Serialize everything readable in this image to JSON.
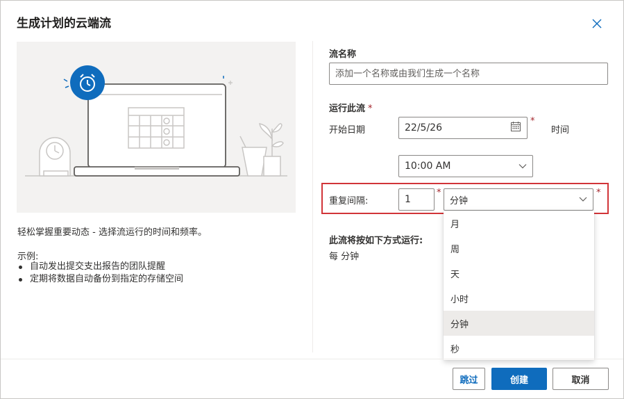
{
  "dialog": {
    "title": "生成计划的云端流",
    "close_icon": "close-icon"
  },
  "left": {
    "description": "轻松掌握重要动态 - 选择流运行的时间和频率。",
    "examples_label": "示例:",
    "examples": [
      "自动发出提交支出报告的团队提醒",
      "定期将数据自动备份到指定的存储空间"
    ]
  },
  "form": {
    "flow_name_label": "流名称",
    "flow_name_placeholder": "添加一个名称或由我们生成一个名称",
    "flow_name_value": "",
    "run_label": "运行此流",
    "required_mark": "*",
    "start_date_label": "开始日期",
    "start_date_value": "22/5/26",
    "time_label": "时间",
    "time_value": "10:00 AM",
    "repeat_label": "重复间隔:",
    "repeat_value": "1",
    "unit_value": "分钟",
    "summary_label": "此流将按如下方式运行:",
    "summary_value": "每 分钟"
  },
  "unit_dropdown": {
    "options": [
      "月",
      "周",
      "天",
      "小时",
      "分钟",
      "秒"
    ],
    "selected_index": 4
  },
  "footer": {
    "skip_label": "跳过",
    "create_label": "创建",
    "cancel_label": "取消"
  },
  "colors": {
    "primary": "#0f6cbd",
    "required": "#a4262c",
    "highlight_border": "#d13438",
    "illustration_bg": "#f3f2f1"
  }
}
